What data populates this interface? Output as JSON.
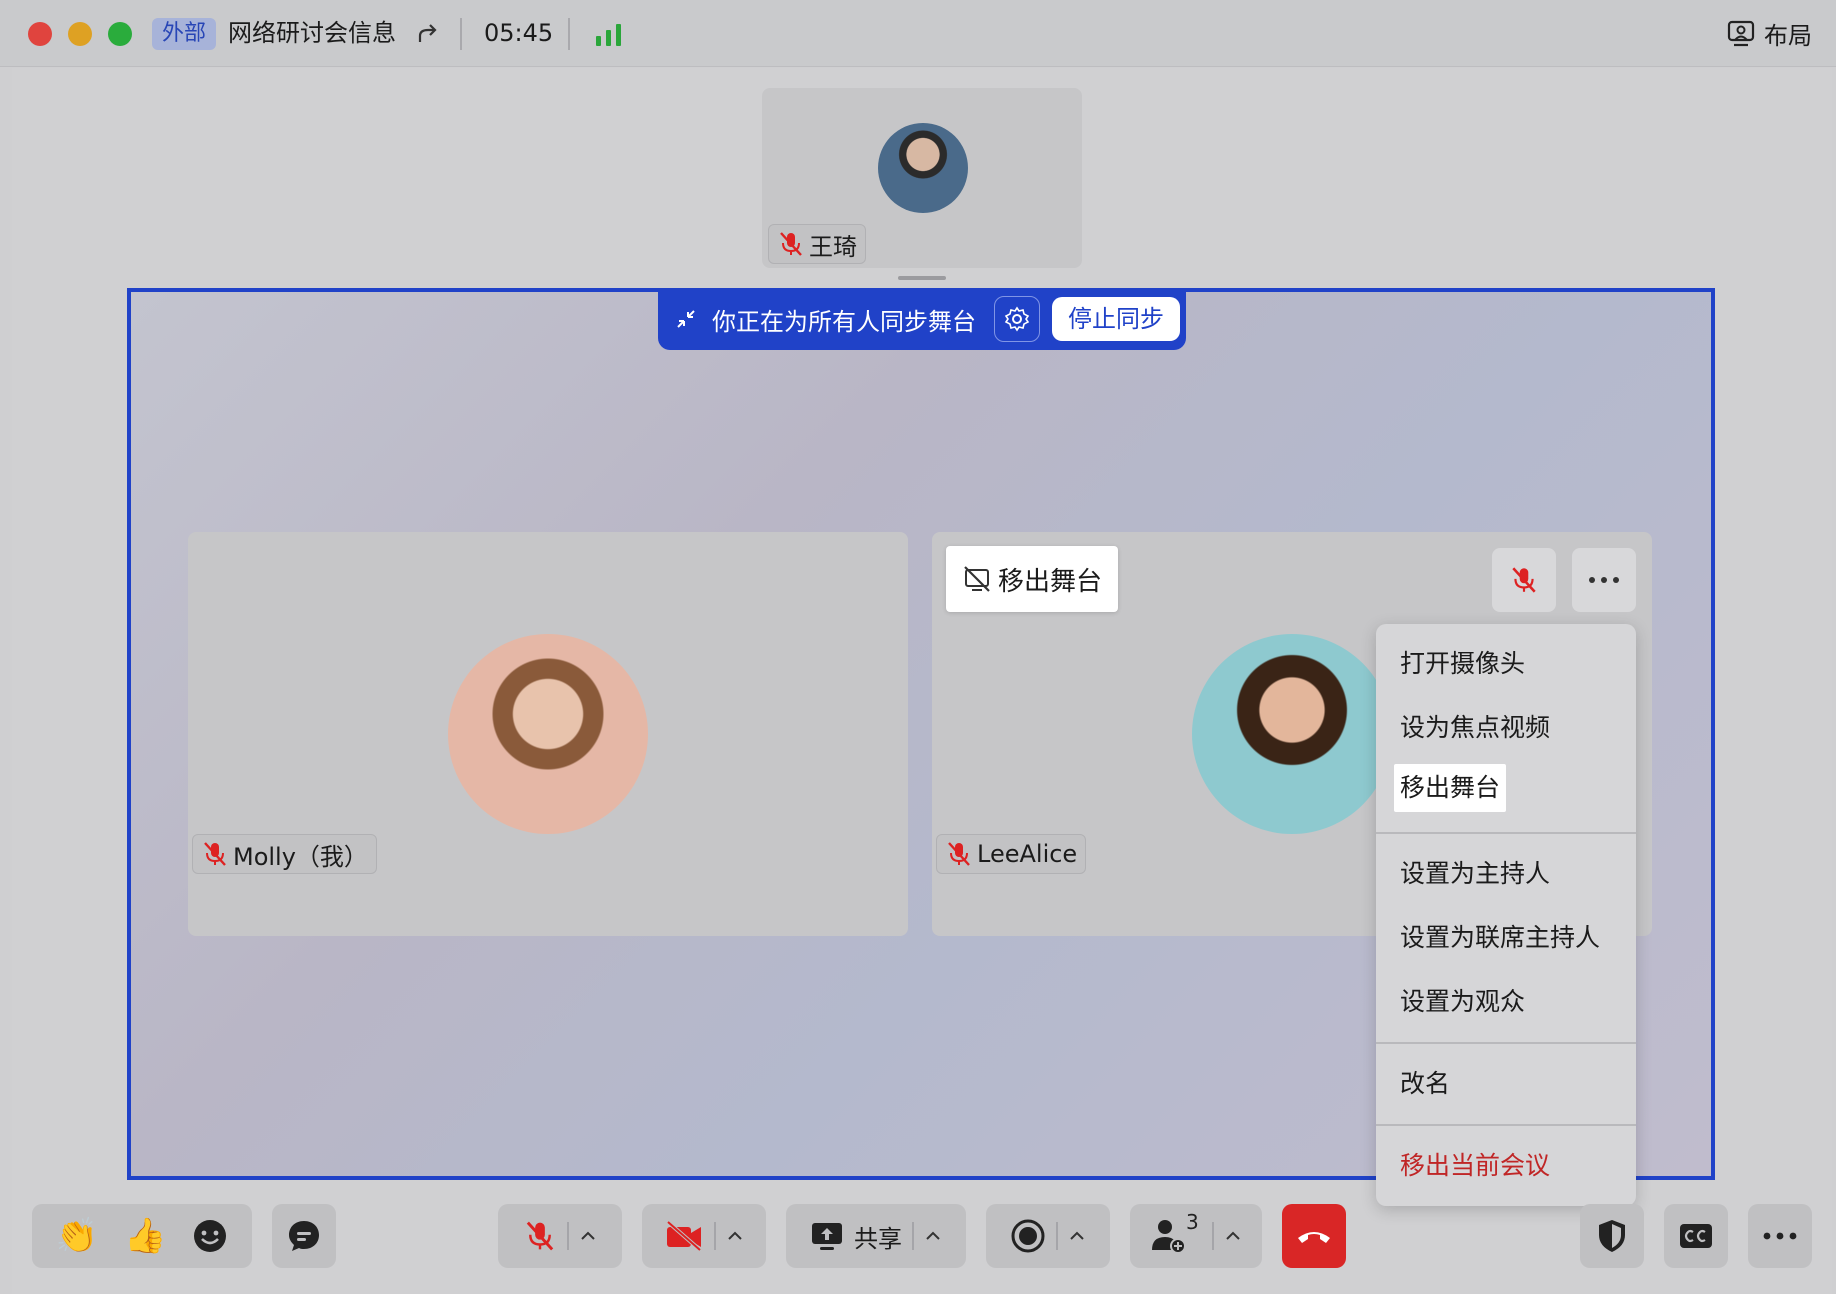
{
  "titlebar": {
    "badge": "外部",
    "title": "网络研讨会信息",
    "timer": "05:45",
    "layout_label": "布局"
  },
  "thumbnail": {
    "name": "王琦"
  },
  "sync_bar": {
    "text": "你正在为所有人同步舞台",
    "stop_label": "停止同步"
  },
  "tiles": [
    {
      "name": "Molly（我）"
    },
    {
      "name": "LeeAlice"
    }
  ],
  "remove_stage_tip": "移出舞台",
  "context_menu": {
    "items": [
      "打开摄像头",
      "设为焦点视频",
      "移出舞台",
      "设置为主持人",
      "设置为联席主持人",
      "设置为观众",
      "改名",
      "移出当前会议"
    ],
    "highlighted_index": 2,
    "danger_index": 7
  },
  "toolbar": {
    "share_label": "共享",
    "participants_count": "3"
  },
  "colors": {
    "accent": "#2042c8",
    "danger": "#d92626",
    "signal": "#2aa63a"
  }
}
